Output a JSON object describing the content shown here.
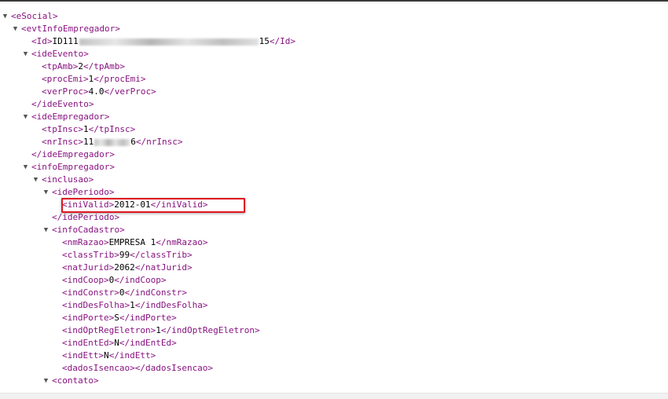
{
  "tree": {
    "rows": [
      {
        "t": "<eSocial>",
        "d": 0,
        "toggle": "open",
        "c": "tag"
      },
      {
        "t": "<evtInfoEmpregador>",
        "d": 1,
        "toggle": "open",
        "c": "tag"
      },
      {
        "open": "<Id>",
        "pre": "ID111",
        "post": "15",
        "close": "</Id>",
        "d": 2
      },
      {
        "t": "<ideEvento>",
        "d": 2,
        "toggle": "open",
        "c": "tag"
      },
      {
        "open": "<tpAmb>",
        "v": "2",
        "close": "</tpAmb>",
        "d": 3
      },
      {
        "open": "<procEmi>",
        "v": "1",
        "close": "</procEmi>",
        "d": 3
      },
      {
        "open": "<verProc>",
        "v": "4.0",
        "close": "</verProc>",
        "d": 3
      },
      {
        "t": "</ideEvento>",
        "d": 2,
        "c": "tag"
      },
      {
        "t": "<ideEmpregador>",
        "d": 2,
        "toggle": "open",
        "c": "tag"
      },
      {
        "open": "<tpInsc>",
        "v": "1",
        "close": "</tpInsc>",
        "d": 3
      },
      {
        "open": "<nrInsc>",
        "pre": "11",
        "post": "6",
        "close": "</nrInsc>",
        "d": 3
      },
      {
        "t": "</ideEmpregador>",
        "d": 2,
        "c": "tag"
      },
      {
        "t": "<infoEmpregador>",
        "d": 2,
        "toggle": "open",
        "c": "tag"
      },
      {
        "t": "<inclusao>",
        "d": 3,
        "toggle": "open",
        "c": "tag"
      },
      {
        "t": "<idePeriodo>",
        "d": 4,
        "toggle": "open",
        "c": "tag"
      },
      {
        "open": "<iniValid>",
        "v": "2012-01",
        "close": "</iniValid>",
        "d": 5
      },
      {
        "t": "</idePeriodo>",
        "d": 4,
        "c": "tag"
      },
      {
        "t": "<infoCadastro>",
        "d": 4,
        "toggle": "open",
        "c": "tag"
      },
      {
        "open": "<nmRazao>",
        "v": "EMPRESA 1",
        "close": "</nmRazao>",
        "d": 5
      },
      {
        "open": "<classTrib>",
        "v": "99",
        "close": "</classTrib>",
        "d": 5
      },
      {
        "open": "<natJurid>",
        "v": "2062",
        "close": "</natJurid>",
        "d": 5
      },
      {
        "open": "<indCoop>",
        "v": "0",
        "close": "</indCoop>",
        "d": 5
      },
      {
        "open": "<indConstr>",
        "v": "0",
        "close": "</indConstr>",
        "d": 5
      },
      {
        "open": "<indDesFolha>",
        "v": "1",
        "close": "</indDesFolha>",
        "d": 5
      },
      {
        "open": "<indPorte>",
        "v": "S",
        "close": "</indPorte>",
        "d": 5
      },
      {
        "open": "<indOptRegEletron>",
        "v": "1",
        "close": "</indOptRegEletron>",
        "d": 5
      },
      {
        "open": "<indEntEd>",
        "v": "N",
        "close": "</indEntEd>",
        "d": 5
      },
      {
        "open": "<indEtt>",
        "v": "N",
        "close": "</indEtt>",
        "d": 5
      },
      {
        "t": "<dadosIsencao></dadosIsencao>",
        "d": 5,
        "c": "tag"
      },
      {
        "t": "<contato>",
        "d": 4,
        "toggle": "open",
        "c": "tag"
      }
    ]
  },
  "highlight": {
    "row": 15,
    "color": "#e0161e"
  },
  "colors": {
    "tag": "#881280",
    "text": "#000000",
    "toggle": "#555555"
  },
  "icons": {
    "toggle_open": "triangle-down-icon"
  }
}
